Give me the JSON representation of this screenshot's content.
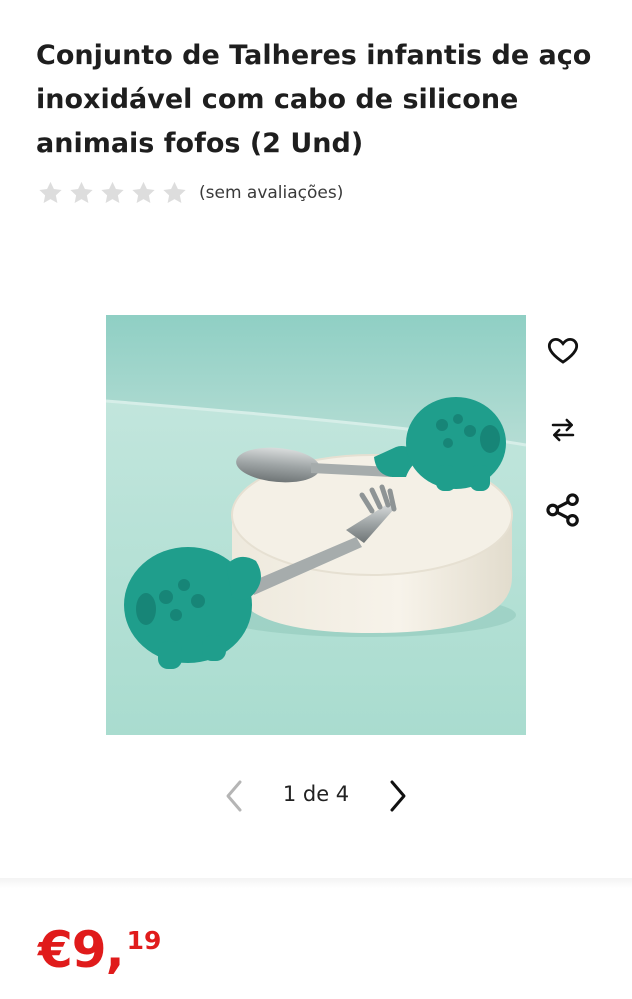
{
  "product": {
    "title": "Conjunto de Talheres infantis de aço inoxidável com cabo de silicone animais fofos (2 Und)",
    "rating": {
      "stars": 0,
      "max_stars": 5,
      "text": "(sem avaliações)"
    },
    "image": {
      "subject": "fork-and-spoon-elephant-handles",
      "accent": "#1f9e8c"
    }
  },
  "actions": {
    "wishlist_icon": "heart-icon",
    "compare_icon": "compare-arrows-icon",
    "share_icon": "share-icon"
  },
  "pager": {
    "current": 1,
    "total": 4,
    "text": "1 de 4",
    "prev_icon": "chevron-left-icon",
    "next_icon": "chevron-right-icon"
  },
  "price": {
    "main": "€9,",
    "cents": "19",
    "color": "#e01b1b"
  },
  "colors": {
    "star_empty": "#dddddd",
    "text": "#1e1e1e"
  }
}
